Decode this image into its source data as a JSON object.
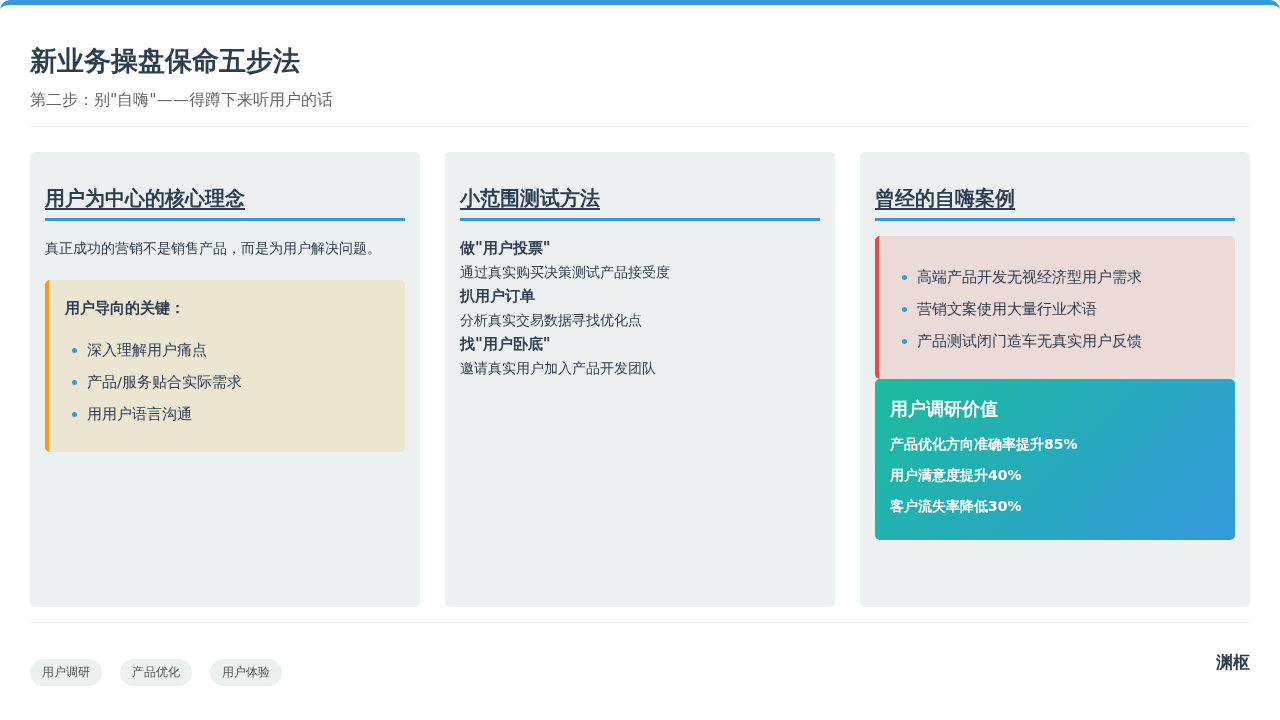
{
  "title": "新业务操盘保命五步法",
  "subtitle": "第二步：别\"自嗨\"——得蹲下来听用户的话",
  "columns": [
    {
      "heading": "用户为中心的核心理念",
      "blocks": [
        {
          "kind": "paragraph",
          "text": "真正成功的营销不是销售产品，而是为用户解决问题。"
        },
        {
          "kind": "callout",
          "color": "#f39c12",
          "title": "用户导向的关键：",
          "items": [
            "深入理解用户痛点",
            "产品/服务贴合实际需求",
            "用用户语言沟通"
          ]
        }
      ]
    },
    {
      "heading": "小范围测试方法",
      "blocks": [
        {
          "kind": "steps",
          "items": [
            {
              "title": "做\"用户投票\"",
              "desc": "通过真实购买决策测试产品接受度"
            },
            {
              "title": "扒用户订单",
              "desc": "分析真实交易数据寻找优化点"
            },
            {
              "title": "找\"用户卧底\"",
              "desc": "邀请真实用户加入产品开发团队"
            }
          ]
        }
      ]
    },
    {
      "heading": "曾经的自嗨案例",
      "blocks": [
        {
          "kind": "callout",
          "color": "#e74c3c",
          "items": [
            "高端产品开发无视经济型用户需求",
            "营销文案使用大量行业术语",
            "产品测试闭门造车无真实用户反馈"
          ]
        },
        {
          "kind": "metrics",
          "title": "用户调研价值",
          "items": [
            "产品优化方向准确率提升85%",
            "用户满意度提升40%",
            "客户流失率降低30%"
          ]
        }
      ]
    }
  ],
  "tags": [
    "用户调研",
    "产品优化",
    "用户体验"
  ],
  "brand": "渊枢"
}
